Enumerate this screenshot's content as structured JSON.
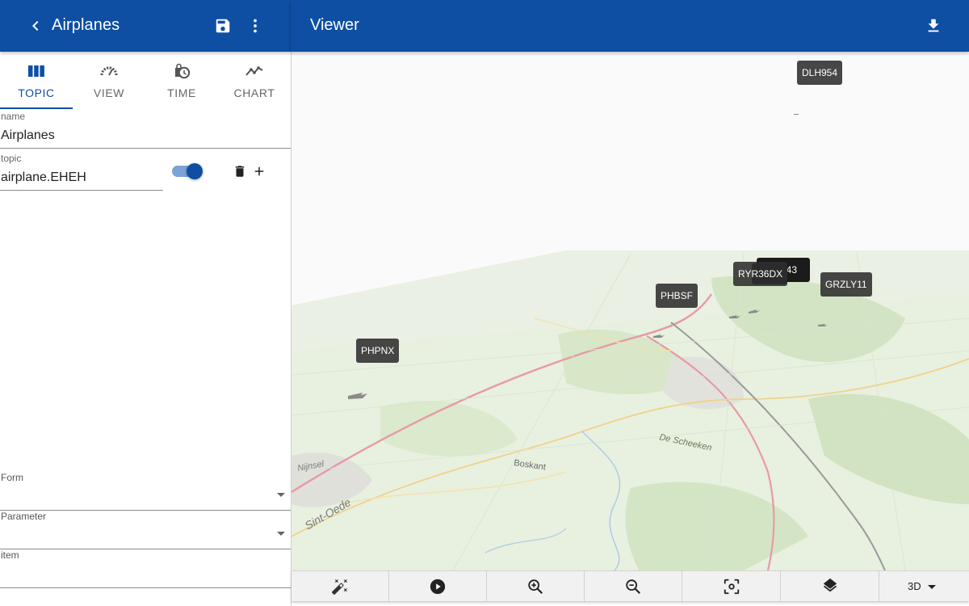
{
  "sidebar": {
    "title": "Airplanes",
    "icons": {
      "back": "chevron-left-icon",
      "save": "save-icon",
      "more": "more-vert-icon"
    },
    "tabs": [
      {
        "label": "TOPIC",
        "icon": "view-column-icon",
        "active": true
      },
      {
        "label": "VIEW",
        "icon": "gauge-icon",
        "active": false
      },
      {
        "label": "TIME",
        "icon": "clock-bag-icon",
        "active": false
      },
      {
        "label": "CHART",
        "icon": "line-chart-icon",
        "active": false
      }
    ],
    "name_field": {
      "label": "name",
      "value": "Airplanes"
    },
    "topic_field": {
      "label": "topic",
      "value": "airplane.EHEH",
      "enabled": true
    },
    "form_select": {
      "label": "Form",
      "value": ""
    },
    "parameter_select": {
      "label": "Parameter",
      "value": ""
    },
    "item_field": {
      "label": "item",
      "value": ""
    }
  },
  "viewer": {
    "title": "Viewer",
    "icons": {
      "download": "download-icon"
    },
    "callsigns": [
      "DLH954",
      "RYR36DX",
      "GRZLY11",
      "PHBSF",
      "PHPNX"
    ],
    "stacked_label_fragment": "043",
    "map_labels": [
      "De Scheeken",
      "Boskant",
      "Sint-Oede",
      "Nijnsel"
    ],
    "toolbar": {
      "buttons": [
        "magic-wand-icon",
        "play-icon",
        "zoom-in-icon",
        "zoom-out-icon",
        "center-focus-icon",
        "layers-icon"
      ],
      "mode": "3D"
    },
    "colors": {
      "primary": "#0e4fa3",
      "map_land": "#e6efd9",
      "map_road": "#e79aa4"
    }
  }
}
